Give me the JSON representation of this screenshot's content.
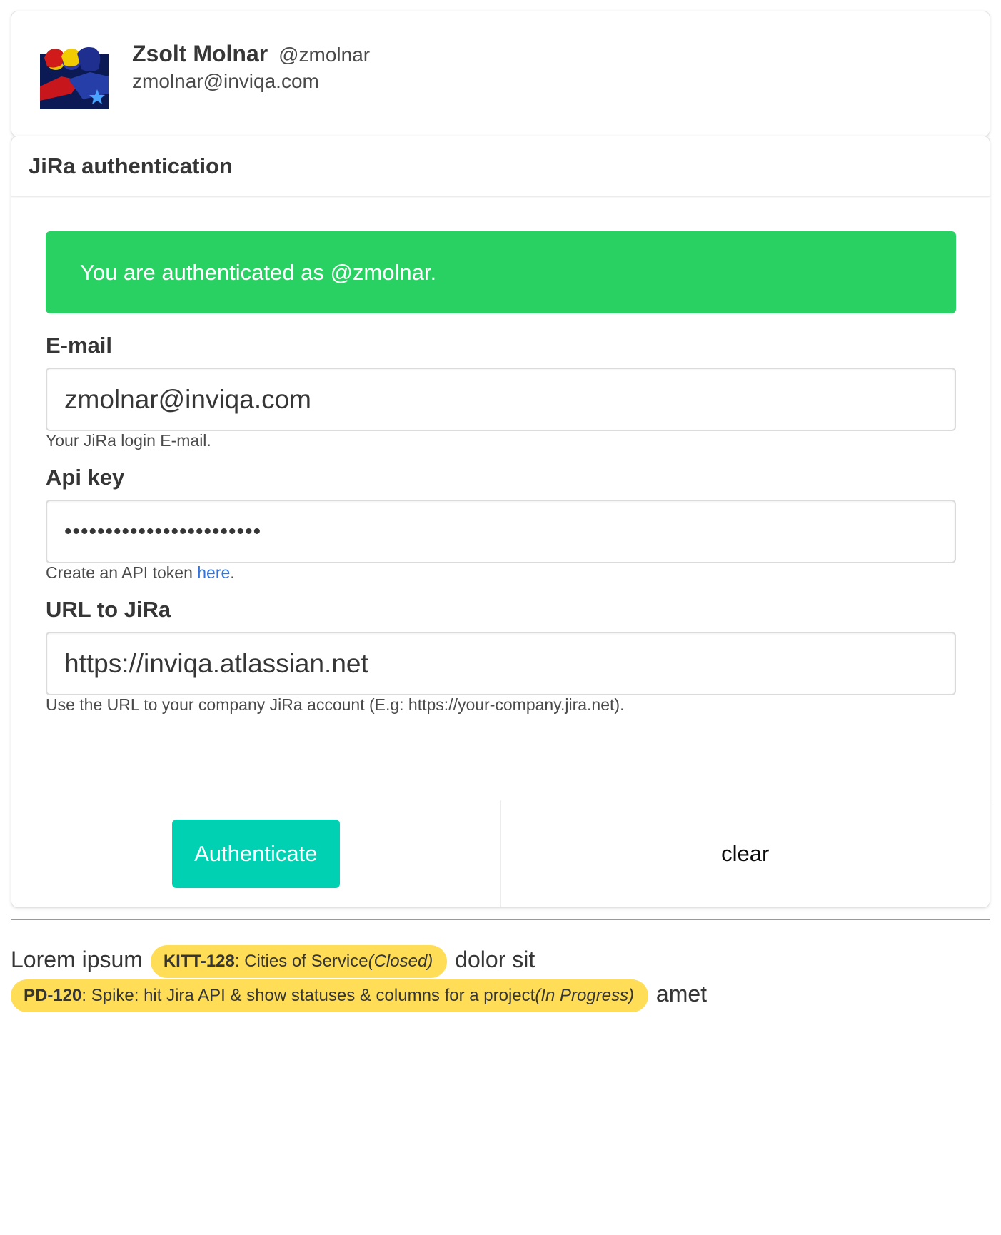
{
  "profile": {
    "name": "Zsolt Molnar",
    "handle": "@zmolnar",
    "email": "zmolnar@inviqa.com"
  },
  "auth_card": {
    "title": "JiRa authentication",
    "notification": "You are authenticated as @zmolnar.",
    "fields": {
      "email": {
        "label": "E-mail",
        "value": "zmolnar@inviqa.com",
        "help": "Your JiRa login E-mail."
      },
      "api_key": {
        "label": "Api key",
        "value": "••••••••••••••••••••••••",
        "help_prefix": "Create an API token ",
        "help_link": "here",
        "help_suffix": "."
      },
      "url": {
        "label": "URL to JiRa",
        "value": "https://inviqa.atlassian.net",
        "help": "Use the URL to your company JiRa account (E.g: https://your-company.jira.net)."
      }
    },
    "footer": {
      "authenticate_label": "Authenticate",
      "clear_label": "clear"
    }
  },
  "lorem": {
    "text1": "Lorem ipsum",
    "text2": "dolor sit",
    "text3": "amet",
    "tickets": [
      {
        "key": "KITT-128",
        "summary": ": Cities of Service",
        "status": "(Closed)"
      },
      {
        "key": "PD-120",
        "summary": ": Spike: hit Jira API & show statuses & columns for a project",
        "status": "(In Progress)"
      }
    ]
  },
  "colors": {
    "success": "#29d162",
    "primary": "#00d1b2",
    "ticket": "#ffdd57",
    "link": "#3273dc"
  }
}
